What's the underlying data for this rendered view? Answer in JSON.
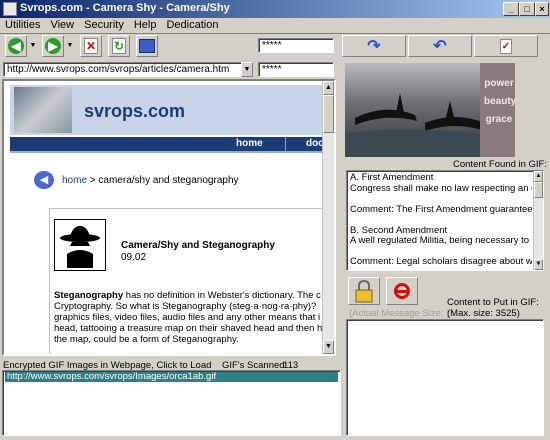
{
  "window": {
    "title": "Svrops.com - Camera Shy - Camera/Shy"
  },
  "menu": [
    "Utilities",
    "View",
    "Security",
    "Help",
    "Dedication"
  ],
  "toolbar": {
    "password1": "*****",
    "password2": "*****"
  },
  "address": {
    "url": "http://www.svrops.com/svrops/articles/camera.htm"
  },
  "page": {
    "logo": "svrops.com",
    "nav": [
      "home",
      "docs"
    ],
    "breadcrumb_home": "home",
    "breadcrumb_rest": "> camera/shy and steganography",
    "article_title": "Camera/Shy and Steganography",
    "article_date": "09.02",
    "body_bold": "Steganography",
    "body_lines": [
      " has no definition in Webster's dictionary. The c",
      "Cryptography.  So what is Steganography (steg·a·nog·ra·phy)?",
      "graphics files, video files, audio files and any other means that i",
      "head, tattooing a treasure map on their shaved head and then h",
      "the map, could be a form of Steganography."
    ]
  },
  "status": {
    "encrypted_label": "Encrypted GIF Images in Webpage, Click to Load",
    "gifs_label": "GIF's Scanned:",
    "gifs_count": "113",
    "selected_url": "http://www.svrops.com/svrops/Images/orca1ab.gif"
  },
  "right": {
    "image_words": [
      "power",
      "beauty",
      "grace"
    ],
    "content_found_label": "Content Found in GIF:",
    "content_lines": [
      "A. First Amendment",
      "Congress shall make no law respecting an establis",
      "",
      "Comment: The First Amendment guarantees freed",
      "",
      "B. Second Amendment",
      "A well regulated Militia, being necessary to the sec",
      "",
      "Comment: Legal scholars disagree about what righ"
    ],
    "actual_size_label": "(Actual Message Size: )",
    "content_put_label": "Content to Put in GIF:",
    "max_size_label": "(Max. size: 3525)"
  },
  "colors": {
    "title_start": "#0a246a",
    "title_end": "#a6caf0",
    "selection": "#2f7f86",
    "svrops_nav": "#1b3c76"
  }
}
